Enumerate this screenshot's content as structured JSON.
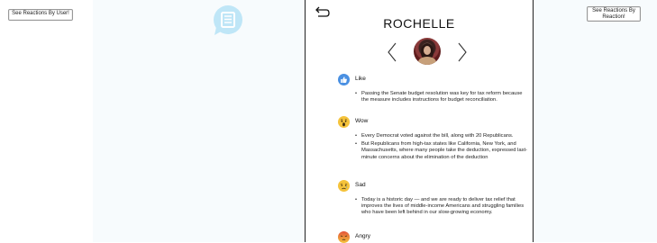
{
  "left_button": {
    "label": "See Reactions By User!"
  },
  "right_button": {
    "label": "See Reactions By Reaction!"
  },
  "panel": {
    "title": "ROCHELLE",
    "sections": [
      {
        "label": "Like",
        "icon": "thumbs-up-icon",
        "color": "#4a90e2",
        "items": [
          "Passing the Senate budget resolution was key for tax reform because the measure includes instructions for budget reconciliation."
        ]
      },
      {
        "label": "Wow",
        "icon": "wow-face-icon",
        "color": "#f5c33b",
        "items": [
          "Every Democrat voted against the bill, along with 20 Republicans.",
          "But Republicans from high-tax states like California, New York, and Massachusetts, where many people take the deduction, expressed last-minute concerns about the elimination of the deduction"
        ]
      },
      {
        "label": "Sad",
        "icon": "sad-face-icon",
        "color": "#f5c33b",
        "items": [
          "Today is a historic day — and we are ready to deliver tax relief that improves the lives of middle-income Americans and struggling families who have been left behind in our slow-growing economy."
        ]
      },
      {
        "label": "Angry",
        "icon": "angry-face-icon",
        "color": "#e8653a",
        "items": []
      }
    ]
  },
  "colors": {
    "accent_blue": "#4a90e2",
    "chat_icon_blue": "#bfe6f7",
    "band": "#f7fbfd"
  }
}
